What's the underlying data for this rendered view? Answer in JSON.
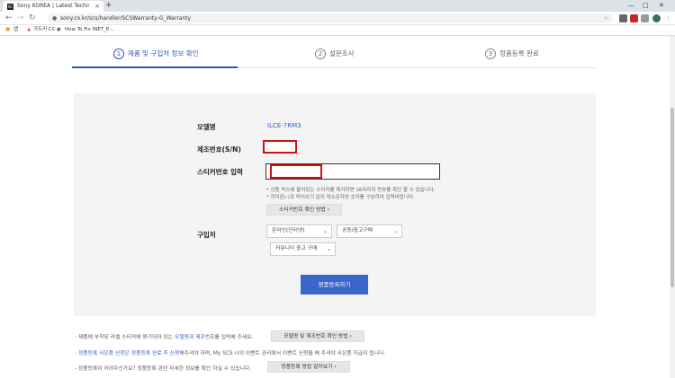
{
  "browser": {
    "tab_title": "Sony KOREA | Latest Technolog...",
    "tab_favicon": "SC",
    "tab_close": "×",
    "new_tab": "+",
    "url": "sony.co.kr/scs/handler/SCSWarranty-G_Warranty",
    "bookmarks": [
      "앱",
      "가도리 CC",
      "How To Fix INET_E..."
    ]
  },
  "steps": [
    {
      "num": "1",
      "label": "제품 및 구입처 정보 확인"
    },
    {
      "num": "2",
      "label": "설문조사"
    },
    {
      "num": "3",
      "label": "정품등록 완료"
    }
  ],
  "form": {
    "model_label": "모델명",
    "model_value": "ILCE-7RM3",
    "serial_label": "제조번호(S/N)",
    "sticker_label": "스티커번호 입력",
    "note1": "* 상품 박스에 붙어있는 스티커를 제거하면 16자리의 번호를 확인 할 수 있습니다.",
    "note2": "* 하이픈(-)과 띄어쓰기 없이 대소문자와 숫자를 구분하여 입력바랍니다.",
    "sticker_help_button": "스티커번호 확인 방법",
    "purchase_label": "구입처",
    "purchase_select_1": "온라인(인터넷)",
    "purchase_select_2": "공동/중고구매",
    "purchase_select_3": "커뮤니티 중고 구매",
    "submit": "정품등록하기"
  },
  "footer": {
    "line1_prefix": "- 제품에 부착된 라벨 스티커에 명기되어 있는 ",
    "line1_hl1": "모델명",
    "line1_mid": "과 ",
    "line1_hl2": "제조번호",
    "line1_suffix": "를 입력해 주세요.",
    "line1_button": "모델명 및 제조번호 확인 방법",
    "line2_prefix": "- ",
    "line2_hl": "정품등록 사은품 신청은 정품등록 완료 후 신청",
    "line2_suffix": "해주셔야 하며, My SCS 나의 이벤트 관리에서 이벤트 신청을 해 주셔야 사은품 지급이 됩니다.",
    "line3": "- 정품등록이 어려우신가요? 정품등록 관련 자세한 정보를 확인 하실 수 있습니다.",
    "line3_button": "정품등록 방법 알아보기"
  }
}
